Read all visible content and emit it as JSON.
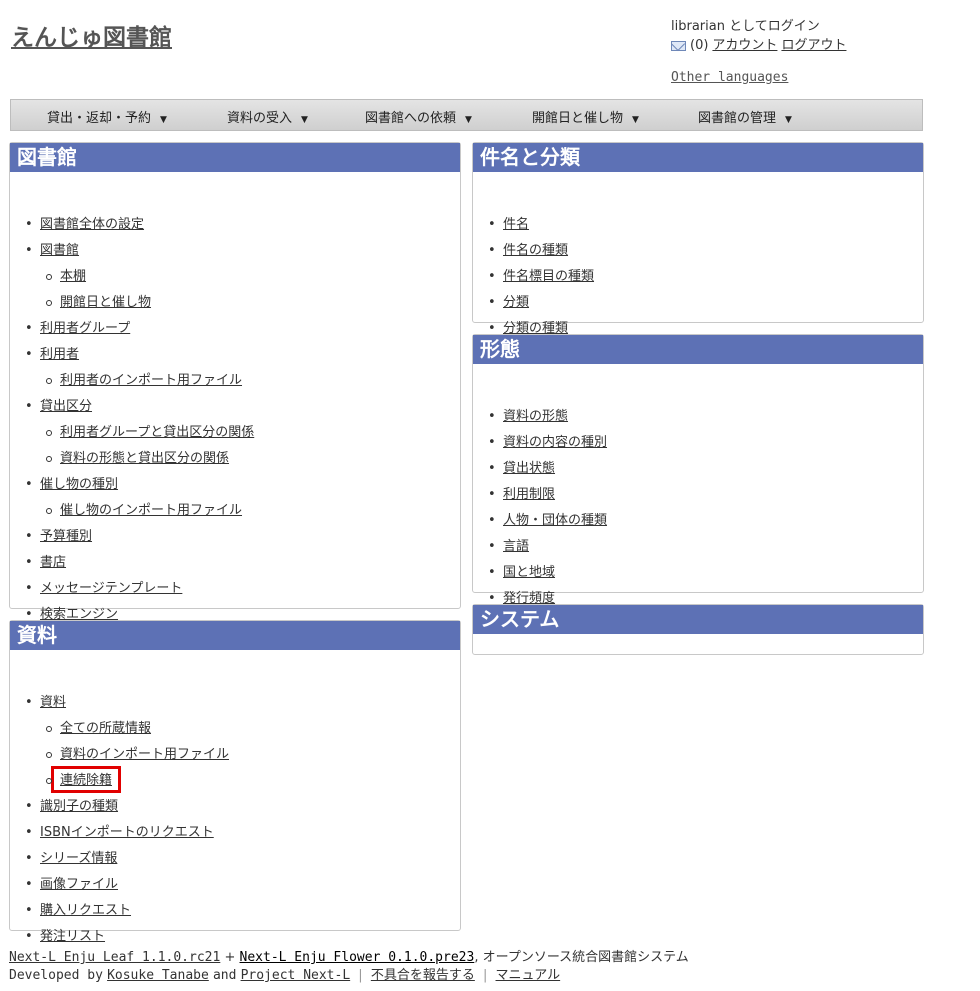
{
  "header": {
    "site_title": "えんじゅ図書館",
    "login_status": "librarian としてログイン",
    "mail_count": "(0)",
    "account_link": "アカウント",
    "logout_link": "ログアウト",
    "other_languages": "Other languages"
  },
  "menu": [
    {
      "label": "貸出・返却・予約"
    },
    {
      "label": "資料の受入"
    },
    {
      "label": "図書館への依頼"
    },
    {
      "label": "開館日と催し物"
    },
    {
      "label": "図書館の管理"
    }
  ],
  "panels": {
    "library": {
      "title": "図書館",
      "items": [
        {
          "label": "図書館全体の設定",
          "level": 1
        },
        {
          "label": "図書館",
          "level": 1
        },
        {
          "label": "本棚",
          "level": 2
        },
        {
          "label": "開館日と催し物",
          "level": 2
        },
        {
          "label": "利用者グループ",
          "level": 1
        },
        {
          "label": "利用者",
          "level": 1
        },
        {
          "label": "利用者のインポート用ファイル",
          "level": 2
        },
        {
          "label": "貸出区分",
          "level": 1
        },
        {
          "label": "利用者グループと貸出区分の関係",
          "level": 2
        },
        {
          "label": "資料の形態と貸出区分の関係",
          "level": 2
        },
        {
          "label": "催し物の種別",
          "level": 1
        },
        {
          "label": "催し物のインポート用ファイル",
          "level": 2
        },
        {
          "label": "予算種別",
          "level": 1
        },
        {
          "label": "書店",
          "level": 1
        },
        {
          "label": "メッセージテンプレート",
          "level": 1
        },
        {
          "label": "検索エンジン",
          "level": 1
        }
      ]
    },
    "materials": {
      "title": "資料",
      "items": [
        {
          "label": "資料",
          "level": 1
        },
        {
          "label": "全ての所蔵情報",
          "level": 2
        },
        {
          "label": "資料のインポート用ファイル",
          "level": 2
        },
        {
          "label": "連続除籍",
          "level": 2,
          "highlighted": true
        },
        {
          "label": "識別子の種類",
          "level": 1
        },
        {
          "label": "ISBNインポートのリクエスト",
          "level": 1
        },
        {
          "label": "シリーズ情報",
          "level": 1
        },
        {
          "label": "画像ファイル",
          "level": 1
        },
        {
          "label": "購入リクエスト",
          "level": 1
        },
        {
          "label": "発注リスト",
          "level": 1
        }
      ]
    },
    "subjects": {
      "title": "件名と分類",
      "items": [
        {
          "label": "件名",
          "level": 1
        },
        {
          "label": "件名の種類",
          "level": 1
        },
        {
          "label": "件名標目の種類",
          "level": 1
        },
        {
          "label": "分類",
          "level": 1
        },
        {
          "label": "分類の種類",
          "level": 1
        }
      ]
    },
    "forms": {
      "title": "形態",
      "items": [
        {
          "label": "資料の形態",
          "level": 1
        },
        {
          "label": "資料の内容の種別",
          "level": 1
        },
        {
          "label": "貸出状態",
          "level": 1
        },
        {
          "label": "利用制限",
          "level": 1
        },
        {
          "label": "人物・団体の種類",
          "level": 1
        },
        {
          "label": "言語",
          "level": 1
        },
        {
          "label": "国と地域",
          "level": 1
        },
        {
          "label": "発行頻度",
          "level": 1
        }
      ]
    },
    "system": {
      "title": "システム",
      "items": []
    }
  },
  "footer": {
    "leaf_link": "Next-L Enju Leaf 1.1.0.rc21",
    "plus": "+",
    "flower_link": "Next-L Enju Flower 0.1.0.pre23",
    "tagline": ", オープンソース統合図書館システム",
    "developed_by": "Developed by",
    "author_link": "Kosuke Tanabe",
    "and": "and",
    "project_link": "Project Next-L",
    "separator": "|",
    "report_link": "不具合を報告する",
    "manual_link": "マニュアル"
  },
  "colors": {
    "panel_header": "#5d71b5",
    "highlight_box": "#e10000"
  },
  "icons": {
    "mail": "mail-icon",
    "menu_caret": "caret-down-icon"
  }
}
